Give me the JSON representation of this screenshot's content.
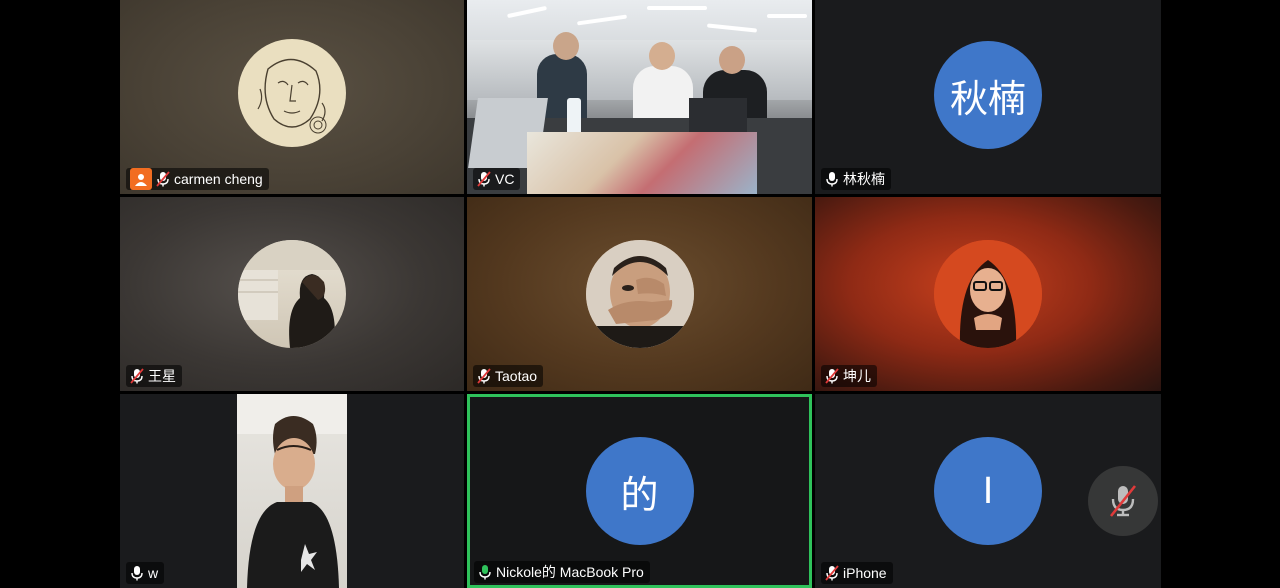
{
  "participants": [
    {
      "name": "carmen cheng",
      "mic": "muted",
      "host": true,
      "avatar": "line-drawing-face"
    },
    {
      "name": "VC",
      "mic": "muted",
      "avatar": "video-meeting-room"
    },
    {
      "name": "林秋楠",
      "mic": "on",
      "initials": "秋楠"
    },
    {
      "name": "王星",
      "mic": "muted",
      "avatar": "photo-person-back"
    },
    {
      "name": "Taotao",
      "mic": "muted",
      "avatar": "photo-face-hands"
    },
    {
      "name": "坤儿",
      "mic": "muted",
      "avatar": "photo-red-portrait"
    },
    {
      "name": "w",
      "mic": "on",
      "avatar": "video-selfie"
    },
    {
      "name": "Nickole的 MacBook Pro",
      "mic": "on",
      "initials": "的",
      "active_speaker": true
    },
    {
      "name": "iPhone",
      "mic": "muted",
      "initials": "I"
    }
  ],
  "colors": {
    "avatar_blue": "#3f77c9",
    "speaker_border": "#2fc25b",
    "host_badge": "#f26d21",
    "muted_slash": "#e03a3a"
  },
  "floating_control": {
    "icon": "mic-muted-icon"
  }
}
